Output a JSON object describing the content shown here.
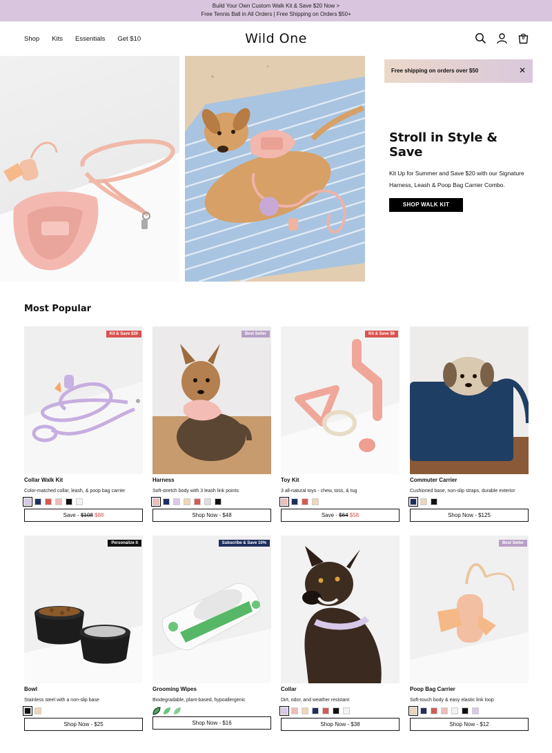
{
  "announcement": {
    "line1": "Build Your Own Custom Walk Kit & Save $20 Now >",
    "line2": "Free Tennis Ball in All Orders | Free Shipping on Orders $50+"
  },
  "nav": {
    "links": [
      "Shop",
      "Kits",
      "Essentials",
      "Get $10"
    ],
    "logo": "Wild One",
    "cart_count": "0",
    "icons": [
      "search-icon",
      "account-icon",
      "cart-icon"
    ]
  },
  "promo_banner": {
    "text": "Free shipping on orders over $50",
    "close": "✕"
  },
  "hero": {
    "title": "Stroll in Style & Save",
    "body": "Kit Up for Summer and Save $20 with our Signature Harness, Leash & Poop Bag Carrier Combo.",
    "button": "SHOP WALK KIT"
  },
  "section_title": "Most Popular",
  "products": [
    {
      "name": "Collar Walk Kit",
      "desc": "Color-matched collar, leash, & poop bag carrier",
      "badge": "Kit & Save $20",
      "badge_color": "#d9534f",
      "swatches": [
        "#d9c8e8",
        "#1e2f5e",
        "#d35b56",
        "#efbcb7",
        "#111111",
        "#f2f2f2"
      ],
      "selected": 0,
      "shop_prefix": "Save - ",
      "old_price": "$108",
      "sale_price": "$88",
      "cta": ""
    },
    {
      "name": "Harness",
      "desc": "Soft-stretch body with 3 leash link points",
      "badge": "Best Seller",
      "badge_color": "#b89fc6",
      "swatches": [
        "#efbcb7",
        "#1e2f5e",
        "#d9c8e8",
        "#eed7b8",
        "#d35b56",
        "#dcdcdc",
        "#111111"
      ],
      "selected": 0,
      "shop_prefix": "",
      "old_price": "",
      "sale_price": "",
      "cta": "Shop Now - $48"
    },
    {
      "name": "Toy Kit",
      "desc": "3 all-natural toys - chew, toss, & tug",
      "badge": "Kit & Save $6",
      "badge_color": "#d9534f",
      "swatches": [
        "#efbcb7",
        "#1e2f5e",
        "#d35b56",
        "#eed7b8"
      ],
      "selected": 0,
      "shop_prefix": "Save - ",
      "old_price": "$64",
      "sale_price": "$58",
      "cta": ""
    },
    {
      "name": "Commuter Carrier",
      "desc": "Cushioned base, non-slip straps, durable exterior",
      "badge": "",
      "badge_color": "",
      "swatches": [
        "#1e2f5e",
        "#eed7b8",
        "#111111"
      ],
      "selected": 0,
      "shop_prefix": "",
      "old_price": "",
      "sale_price": "",
      "cta": "Shop Now - $125"
    },
    {
      "name": "Bowl",
      "desc": "Stainless steel with a non-slip base",
      "badge": "Personalize it",
      "badge_color": "#111111",
      "swatches": [
        "#111111",
        "#eed7b8"
      ],
      "selected": 0,
      "shop_prefix": "",
      "old_price": "",
      "sale_price": "",
      "cta": "Shop Now - $25"
    },
    {
      "name": "Grooming Wipes",
      "desc": "Biodegradable, plant-based, hypoallergenic",
      "badge": "Subscribe & Save 10%",
      "badge_color": "#1e2f5e",
      "swatches": [],
      "leaves": 3,
      "selected": 0,
      "shop_prefix": "",
      "old_price": "",
      "sale_price": "",
      "cta": "Shop Now - $16"
    },
    {
      "name": "Collar",
      "desc": "Dirt, odor, and weather resistant",
      "badge": "",
      "badge_color": "",
      "swatches": [
        "#d9c8e8",
        "#efbcb7",
        "#eed7b8",
        "#1e2f5e",
        "#d35b56",
        "#111111",
        "#f2f2f2"
      ],
      "selected": 0,
      "shop_prefix": "",
      "old_price": "",
      "sale_price": "",
      "cta": "Shop Now - $38"
    },
    {
      "name": "Poop Bag Carrier",
      "desc": "Soft-touch body & easy elastic link loop",
      "badge": "Best Seller",
      "badge_color": "#b89fc6",
      "swatches": [
        "#eed7b8",
        "#1e2f5e",
        "#d35b56",
        "#efbcb7",
        "#f2f2f2",
        "#111111",
        "#d9c8e8"
      ],
      "selected": 0,
      "shop_prefix": "",
      "old_price": "",
      "sale_price": "",
      "cta": "Shop Now - $12"
    }
  ]
}
